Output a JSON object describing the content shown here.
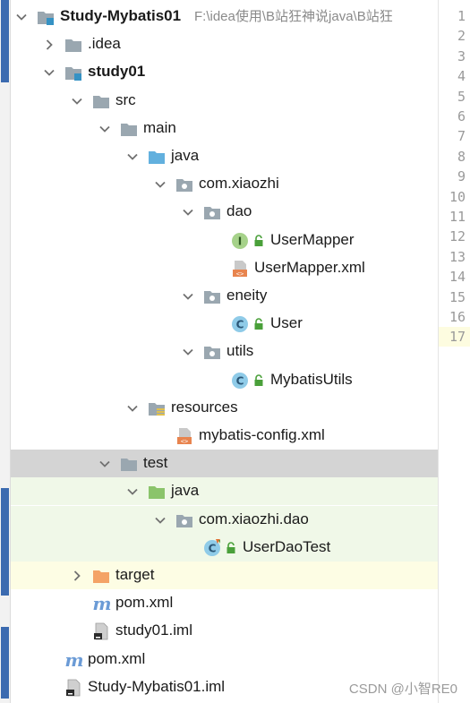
{
  "project": {
    "name": "Study-Mybatis01",
    "path": "F:\\idea使用\\B站狂神说java\\B站狂"
  },
  "tree": [
    {
      "label": "Study-Mybatis01",
      "icon": "module-folder-icon",
      "chevron": "down",
      "bold": true
    },
    {
      "label": ".idea",
      "icon": "folder-icon",
      "chevron": "right"
    },
    {
      "label": "study01",
      "icon": "module-folder-icon",
      "chevron": "down",
      "bold": true
    },
    {
      "label": "src",
      "icon": "folder-icon",
      "chevron": "down"
    },
    {
      "label": "main",
      "icon": "folder-icon",
      "chevron": "down"
    },
    {
      "label": "java",
      "icon": "source-folder-icon",
      "chevron": "down"
    },
    {
      "label": "com.xiaozhi",
      "icon": "package-icon",
      "chevron": "down"
    },
    {
      "label": "dao",
      "icon": "package-icon",
      "chevron": "down"
    },
    {
      "label": "UserMapper",
      "icon": "interface-icon"
    },
    {
      "label": "UserMapper.xml",
      "icon": "xml-file-icon"
    },
    {
      "label": "eneity",
      "icon": "package-icon",
      "chevron": "down"
    },
    {
      "label": "User",
      "icon": "class-icon"
    },
    {
      "label": "utils",
      "icon": "package-icon",
      "chevron": "down"
    },
    {
      "label": "MybatisUtils",
      "icon": "class-icon"
    },
    {
      "label": "resources",
      "icon": "resources-folder-icon",
      "chevron": "down"
    },
    {
      "label": "mybatis-config.xml",
      "icon": "xml-file-icon"
    },
    {
      "label": "test",
      "icon": "folder-icon",
      "chevron": "down"
    },
    {
      "label": "java",
      "icon": "test-source-folder-icon",
      "chevron": "down"
    },
    {
      "label": "com.xiaozhi.dao",
      "icon": "package-icon",
      "chevron": "down"
    },
    {
      "label": "UserDaoTest",
      "icon": "test-class-icon"
    },
    {
      "label": "target",
      "icon": "excluded-folder-icon",
      "chevron": "right"
    },
    {
      "label": "pom.xml",
      "icon": "maven-icon"
    },
    {
      "label": "study01.iml",
      "icon": "iml-file-icon"
    },
    {
      "label": "pom.xml",
      "icon": "maven-icon"
    },
    {
      "label": "Study-Mybatis01.iml",
      "icon": "iml-file-icon"
    }
  ],
  "line_numbers": [
    "1",
    "2",
    "3",
    "4",
    "5",
    "6",
    "7",
    "8",
    "9",
    "10",
    "11",
    "12",
    "13",
    "14",
    "15",
    "16",
    "17"
  ],
  "colors": {
    "selection": "#d4d4d4",
    "test_highlight": "#f0f8e8",
    "excluded_highlight": "#fdfde4",
    "folder": "#9aa7b0",
    "source_folder": "#62b0de",
    "test_folder": "#8bc46b",
    "excluded_folder": "#f4a366",
    "class_circle": "#8fcbe8",
    "interface_circle": "#a6d28a",
    "maven": "#6b9bd6"
  },
  "watermark": "CSDN @小智RE0"
}
